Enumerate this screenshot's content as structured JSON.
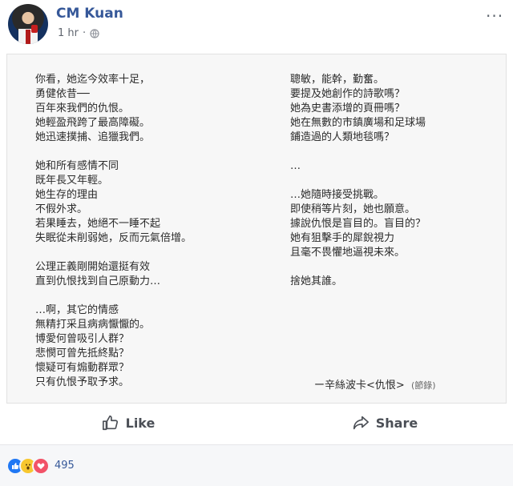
{
  "post": {
    "author": "CM Kuan",
    "time": "1 hr",
    "more": "..."
  },
  "poem": {
    "left": "你看，她迄今效率十足，\n勇健依昔──\n百年來我們的仇恨。\n她輕盈飛跨了最高障礙。\n她迅速撲捕、追獵我們。\n\n她和所有感情不同\n既年長又年輕。\n她生存的理由\n不假外求。\n若果睡去，她絕不一睡不起\n失眠從未削弱她，反而元氣倍增。\n\n公理正義剛開始還挺有效\n直到仇恨找到自己原動力…\n\n…啊，其它的情感\n無精打采且病病懨懨的。\n博愛何曾吸引人群？\n悲憫可曾先抵終點？\n懷疑可有煽動群眾？\n只有仇恨予取予求。",
    "right": "聰敏，能幹，勤奮。\n要提及她創作的詩歌嗎？\n她為史書添增的頁冊嗎？\n她在無數的市鎮廣場和足球場\n鋪造過的人類地毯嗎？\n\n…\n\n…她隨時接受挑戰。\n即使稍等片刻，她也願意。\n據說仇恨是盲目的。盲目的？\n她有狙擊手的犀銳視力\n且毫不畏懼地逼視未來。\n\n捨她其誰。",
    "attribution": "ー辛絲波卡<仇恨>",
    "attribution_note": "(節錄)"
  },
  "actions": {
    "like": "Like",
    "share": "Share"
  },
  "reactions": {
    "count": "495",
    "icons": [
      "like-icon",
      "wow-icon",
      "love-icon"
    ]
  },
  "colors": {
    "brand": "#365899",
    "like": "#2078f4",
    "wow": "#f7c72f",
    "love": "#f25268"
  }
}
